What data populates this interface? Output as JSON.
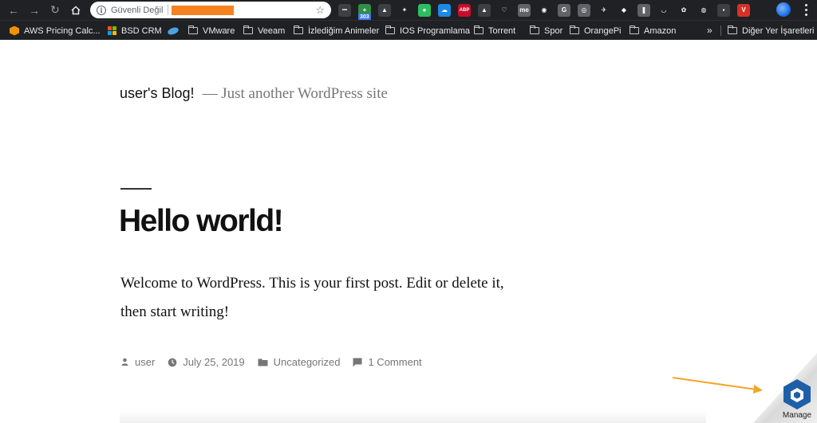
{
  "browser": {
    "security_text": "Güvenli Değil",
    "extensions": [
      {
        "name": "ext-dots",
        "color": "#3c4043",
        "glyph": "•••"
      },
      {
        "name": "ext-rss",
        "color": "#2f8f46",
        "glyph": "+",
        "badge": "303"
      },
      {
        "name": "ext-shield",
        "color": "#3c4043",
        "glyph": "▲"
      },
      {
        "name": "ext-bird",
        "color": "#202124",
        "glyph": "✦"
      },
      {
        "name": "ext-evernote",
        "color": "#2dbe60",
        "glyph": "●"
      },
      {
        "name": "ext-cloud",
        "color": "#1e88e5",
        "glyph": "☁"
      },
      {
        "name": "ext-abp",
        "color": "#c70d2c",
        "glyph": "ABP"
      },
      {
        "name": "ext-drive",
        "color": "#3c4043",
        "glyph": "▲"
      },
      {
        "name": "ext-heart",
        "color": "#202124",
        "glyph": "♡"
      },
      {
        "name": "ext-me",
        "color": "#5f6368",
        "glyph": "me"
      },
      {
        "name": "ext-circle",
        "color": "#202124",
        "glyph": "◉"
      },
      {
        "name": "ext-g",
        "color": "#5f6368",
        "glyph": "G"
      },
      {
        "name": "ext-bulb",
        "color": "#5f6368",
        "glyph": "◎"
      },
      {
        "name": "ext-ufo",
        "color": "#202124",
        "glyph": "✈"
      },
      {
        "name": "ext-drop",
        "color": "#202124",
        "glyph": "◆"
      },
      {
        "name": "ext-bookmark",
        "color": "#5f6368",
        "glyph": "❚"
      },
      {
        "name": "ext-pocket",
        "color": "#202124",
        "glyph": "◡"
      },
      {
        "name": "ext-gear",
        "color": "#202124",
        "glyph": "✿"
      },
      {
        "name": "ext-chat",
        "color": "#202124",
        "glyph": "◍"
      },
      {
        "name": "ext-gray",
        "color": "#3c4043",
        "glyph": "▪"
      },
      {
        "name": "ext-v",
        "color": "#d93025",
        "glyph": "V"
      }
    ]
  },
  "bookmarks": [
    {
      "label": "AWS Pricing Calc...",
      "icon": "aws-icon"
    },
    {
      "label": "BSD CRM",
      "icon": "microsoft-icon"
    },
    {
      "label": "",
      "icon": "vm-icon"
    },
    {
      "label": "VMware",
      "icon": "folder-icon"
    },
    {
      "label": "Veeam",
      "icon": "folder-icon"
    },
    {
      "label": "İzlediğim Animeler",
      "icon": "folder-icon"
    },
    {
      "label": "IOS Programlama",
      "icon": "folder-icon"
    },
    {
      "label": "Torrent",
      "icon": "folder-icon"
    },
    {
      "label": "Spor",
      "icon": "folder-icon"
    },
    {
      "label": "OrangePi",
      "icon": "folder-icon"
    },
    {
      "label": "Amazon",
      "icon": "folder-icon"
    }
  ],
  "bookmarks_overflow": "»",
  "other_bookmarks": "Diğer Yer İşaretleri",
  "site": {
    "title": "user's Blog!",
    "description": "— Just another WordPress site"
  },
  "post": {
    "title": "Hello world!",
    "content": "Welcome to WordPress. This is your first post. Edit or delete it, then start writing!",
    "author": "user",
    "date": "July 25, 2019",
    "category": "Uncategorized",
    "comments": "1 Comment"
  },
  "widget": {
    "label": "Manage",
    "accent_color": "#1f5fa8"
  },
  "colors": {
    "annotation_arrow": "#f5a623"
  }
}
